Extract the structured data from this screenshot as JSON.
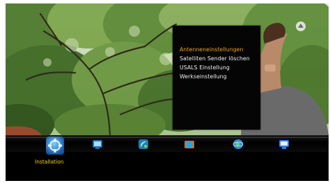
{
  "menu": {
    "items": [
      {
        "label": "Antenneneinstellungen",
        "selected": true
      },
      {
        "label": "Satelliten Sender löschen",
        "selected": false
      },
      {
        "label": "USALS Einstellung",
        "selected": false
      },
      {
        "label": "Werkseinstellung",
        "selected": false
      }
    ]
  },
  "iconbar": {
    "selected_label": "Installation",
    "icons": [
      {
        "name": "installation-icon",
        "selected": true
      },
      {
        "name": "tv-icon",
        "selected": false
      },
      {
        "name": "satellite-dish-icon",
        "selected": false
      },
      {
        "name": "folder-icon",
        "selected": false
      },
      {
        "name": "globe-icon",
        "selected": false
      },
      {
        "name": "monitor-icon",
        "selected": false
      }
    ]
  },
  "colors": {
    "menu_selected": "#f2a21e",
    "menu_text": "#f2f2f2",
    "label": "#f5d20f"
  }
}
